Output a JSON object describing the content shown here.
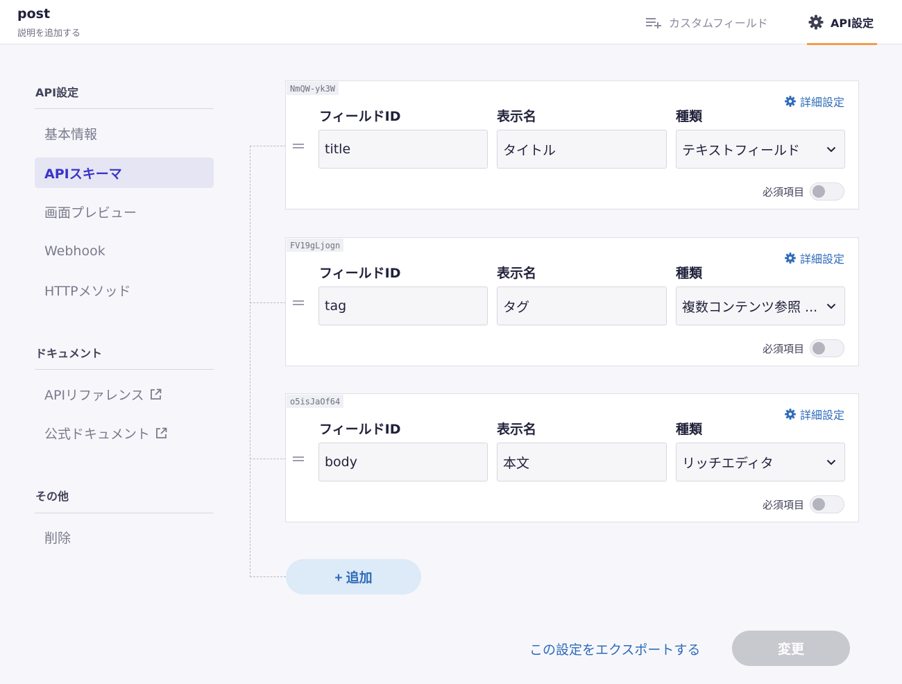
{
  "header": {
    "title": "post",
    "subtitle": "説明を追加する",
    "tabs": [
      {
        "label": "カスタムフィールド",
        "icon": "list-add-icon"
      },
      {
        "label": "API設定",
        "icon": "gear-icon",
        "active": true
      }
    ]
  },
  "sidebar": {
    "sections": [
      {
        "title": "API設定",
        "items": [
          {
            "label": "基本情報"
          },
          {
            "label": "APIスキーマ",
            "active": true
          },
          {
            "label": "画面プレビュー"
          },
          {
            "label": "Webhook"
          },
          {
            "label": "HTTPメソッド"
          }
        ]
      },
      {
        "title": "ドキュメント",
        "items": [
          {
            "label": "APIリファレンス",
            "icon": "external-link-icon"
          },
          {
            "label": "公式ドキュメント",
            "icon": "external-link-icon"
          }
        ]
      },
      {
        "title": "その他",
        "items": [
          {
            "label": "削除"
          }
        ]
      }
    ]
  },
  "schema": {
    "column_labels": {
      "field_id": "フィールドID",
      "display_name": "表示名",
      "kind": "種類"
    },
    "detail_label": "詳細設定",
    "required_label": "必須項目",
    "fields": [
      {
        "id_tag": "NmQW-yk3W",
        "field_id": "title",
        "display_name": "タイトル",
        "kind": "テキストフィールド",
        "required": false
      },
      {
        "id_tag": "FV19gLjogn",
        "field_id": "tag",
        "display_name": "タグ",
        "kind": "複数コンテンツ参照 ...",
        "required": false
      },
      {
        "id_tag": "o5isJaOf64",
        "field_id": "body",
        "display_name": "本文",
        "kind": "リッチエディタ",
        "required": false
      }
    ],
    "add_label": "+ 追加"
  },
  "footer": {
    "export_label": "この設定をエクスポートする",
    "submit_label": "変更"
  },
  "colors": {
    "accent": "#3b34c8",
    "link": "#2e6bb8",
    "tab_underline": "#f29d4b",
    "disabled_button": "#c8c8cf"
  }
}
